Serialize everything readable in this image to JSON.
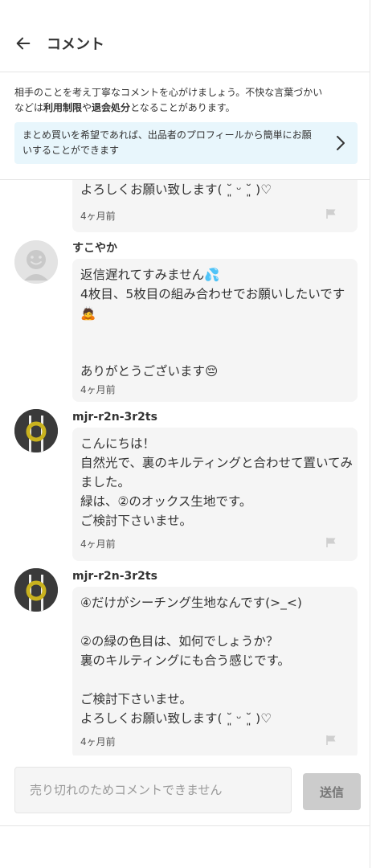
{
  "header": {
    "title": "コメント"
  },
  "notice": {
    "line1": "相手のことを考え丁寧なコメントを心がけましょう。不快な言葉づかい",
    "line2_pre": "などは",
    "line2_bold1": "利用制限",
    "line2_mid": "や",
    "line2_bold2": "退会処分",
    "line2_post": "となることがあります。"
  },
  "banner": {
    "text": "まとめ買いを希望であれば、出品者のプロフィールから簡単にお願いすることができます"
  },
  "comments": [
    {
      "username": "",
      "text": "よろしくお願い致します( ˘͈ ᵕ ˘͈ )♡",
      "time": "4ヶ月前"
    },
    {
      "username": "すこやか",
      "text": "返信遅れてすみません💦\n4枚目、5枚目の組み合わせでお願いしたいです🙇\n\n\nありがとうございます😔",
      "time": "4ヶ月前"
    },
    {
      "username": "mjr-r2n-3r2ts",
      "text": "こんにちは！\n自然光で、裏のキルティングと合わせて置いてみました。\n緑は、②のオックス生地です。\nご検討下さいませ。",
      "time": "4ヶ月前"
    },
    {
      "username": "mjr-r2n-3r2ts",
      "text": "④だけがシーチング生地なんです(>_<)\n\n②の緑の色目は、如何でしょうか？\n裏のキルティングにも合う感じです。\n\nご検討下さいませ。\nよろしくお願い致します( ˘͈ ᵕ ˘͈ )♡",
      "time": "4ヶ月前"
    }
  ],
  "footer": {
    "placeholder": "売り切れのためコメントできません",
    "send_label": "送信"
  }
}
